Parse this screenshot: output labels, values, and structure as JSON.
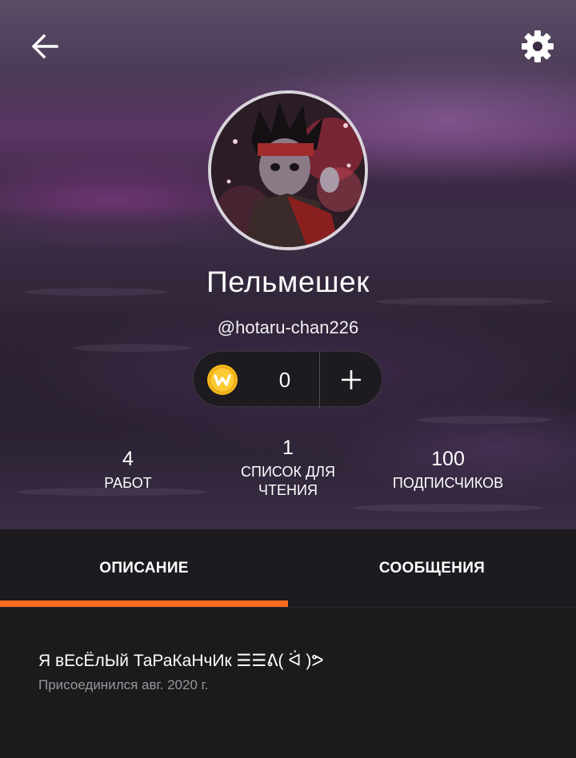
{
  "profile": {
    "display_name": "Пельмешек",
    "username": "@hotaru-chan226"
  },
  "coins": {
    "count": "0",
    "icon": "wattpad-coin-icon"
  },
  "stats": {
    "works": {
      "value": "4",
      "label": "РАБОТ"
    },
    "reading_list": {
      "value": "1",
      "label": "СПИСОК ДЛЯ ЧТЕНИЯ"
    },
    "followers": {
      "value": "100",
      "label": "ПОДПИСЧИКОВ"
    }
  },
  "tabs": [
    {
      "label": "ОПИСАНИЕ",
      "active": true
    },
    {
      "label": "СООБЩЕНИЯ",
      "active": false
    }
  ],
  "about": {
    "bio": "Я вЕсЁлЫй ТаРаКаНчИк ☰☰ᕕ( ᐛ )ᕗ",
    "joined": "Присоединился авг. 2020 г."
  },
  "colors": {
    "accent": "#ff6b22",
    "coin": "#f5b81e",
    "surface": "#1d1b1f"
  }
}
